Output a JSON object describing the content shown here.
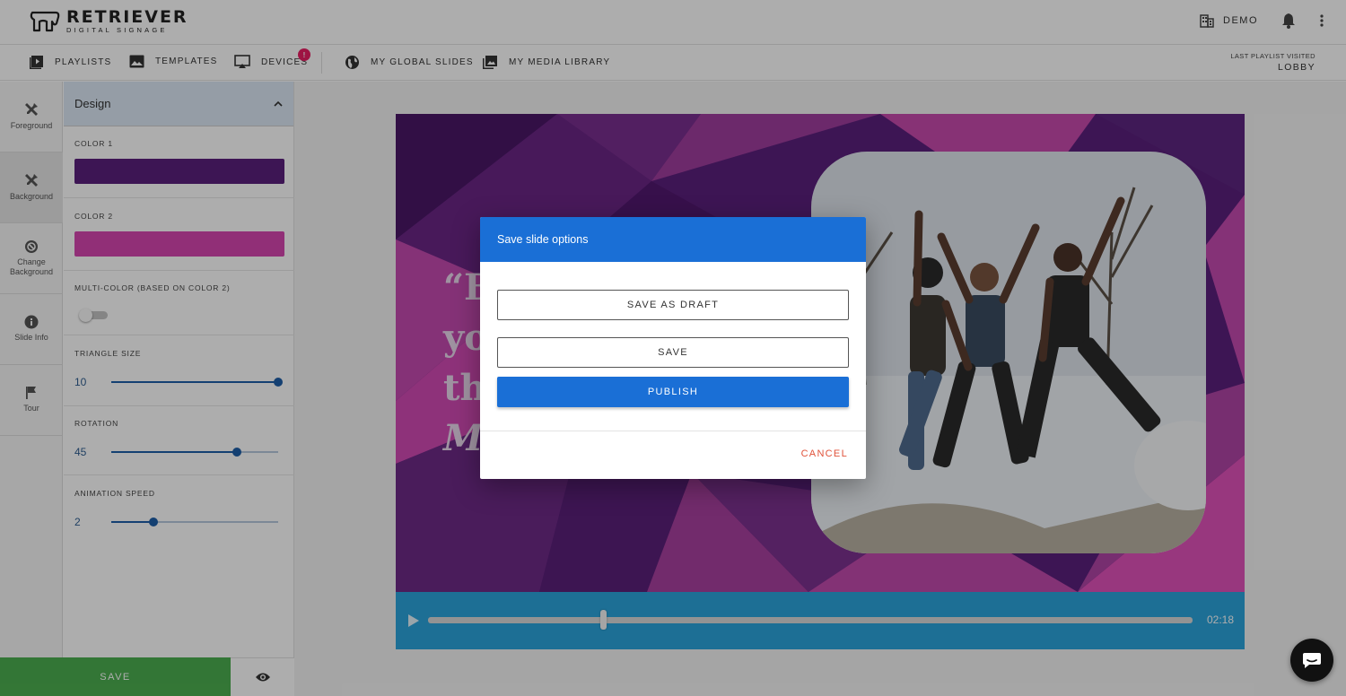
{
  "brand": {
    "name": "RETRIEVER",
    "tagline": "DIGITAL SIGNAGE"
  },
  "account": {
    "label": "DEMO"
  },
  "nav": {
    "items": [
      {
        "label": "PLAYLISTS",
        "icon": "playlist-play-icon"
      },
      {
        "label": "TEMPLATES",
        "icon": "image-icon"
      },
      {
        "label": "DEVICES",
        "icon": "cast-icon",
        "badge": "!"
      },
      {
        "label": "MY GLOBAL SLIDES",
        "icon": "globe-icon"
      },
      {
        "label": "MY MEDIA LIBRARY",
        "icon": "photo-library-icon"
      }
    ],
    "last_visited_label": "LAST PLAYLIST VISITED",
    "last_visited_value": "LOBBY"
  },
  "rail": {
    "items": [
      {
        "label": "Foreground",
        "icon": "tools-icon"
      },
      {
        "label": "Background",
        "icon": "tools-icon",
        "active": true
      },
      {
        "label": "Change Background",
        "icon": "block-icon"
      },
      {
        "label": "Slide Info",
        "icon": "info-icon"
      },
      {
        "label": "Tour",
        "icon": "flag-icon"
      }
    ]
  },
  "design": {
    "title": "Design",
    "color1_label": "COLOR 1",
    "color1": "#5b1f7c",
    "color2_label": "COLOR 2",
    "color2": "#d646b0",
    "multicolor_label": "MULTI-COLOR (BASED ON COLOR 2)",
    "multicolor_on": false,
    "triangle_label": "TRIANGLE SIZE",
    "triangle_value": "10",
    "triangle_fraction": 1.0,
    "rotation_label": "ROTATION",
    "rotation_value": "45",
    "rotation_fraction": 0.75,
    "speed_label": "ANIMATION SPEED",
    "speed_value": "2",
    "speed_fraction": 0.25
  },
  "footer": {
    "save_label": "SAVE"
  },
  "slide": {
    "quote_lines": [
      "“Be",
      "yo",
      "the",
      "M"
    ],
    "bg_dark": "#5b1f7c",
    "bg_pink": "#d646b0"
  },
  "player": {
    "time": "02:18",
    "progress_fraction": 0.225
  },
  "modal": {
    "title": "Save slide options",
    "save_draft_label": "SAVE AS DRAFT",
    "save_label": "SAVE",
    "publish_label": "PUBLISH",
    "cancel_label": "CANCEL"
  }
}
